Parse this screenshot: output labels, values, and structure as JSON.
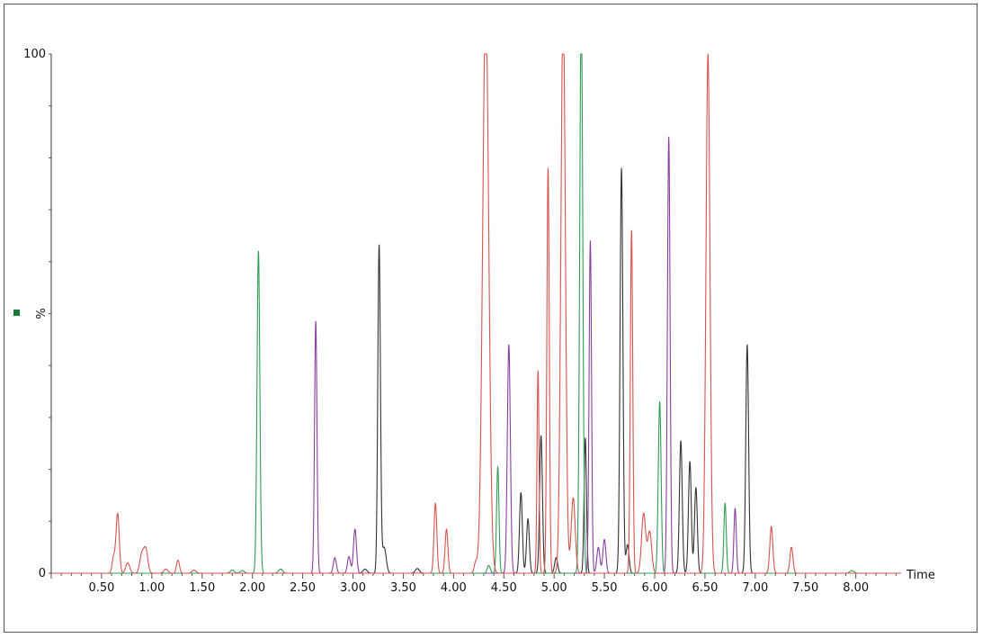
{
  "chart_data": {
    "type": "line",
    "title": "",
    "xlabel": "Time",
    "ylabel": "%",
    "xlim": [
      0.0,
      8.45
    ],
    "ylim": [
      0,
      100
    ],
    "x_ticks": [
      "0.50",
      "1.00",
      "1.50",
      "2.00",
      "2.50",
      "3.00",
      "3.50",
      "4.00",
      "4.50",
      "5.00",
      "5.50",
      "6.00",
      "6.50",
      "7.00",
      "7.50",
      "8.00"
    ],
    "y_ticks": [
      "0",
      "100"
    ],
    "marker_color": "#1a7a3a",
    "grid": false,
    "series_colors": {
      "red": "#d9534f",
      "green": "#2e9e55",
      "purple": "#8a3fa0",
      "black": "#333333"
    },
    "peaks": [
      {
        "color": "red",
        "x": 0.62,
        "h": 3.0,
        "w": 0.015
      },
      {
        "color": "red",
        "x": 0.66,
        "h": 11.5,
        "w": 0.016
      },
      {
        "color": "red",
        "x": 0.76,
        "h": 2.0,
        "w": 0.02
      },
      {
        "color": "red",
        "x": 0.9,
        "h": 3.5,
        "w": 0.02
      },
      {
        "color": "red",
        "x": 0.94,
        "h": 4.5,
        "w": 0.02
      },
      {
        "color": "red",
        "x": 1.14,
        "h": 0.8,
        "w": 0.02
      },
      {
        "color": "red",
        "x": 1.26,
        "h": 2.5,
        "w": 0.015
      },
      {
        "color": "red",
        "x": 1.42,
        "h": 0.6,
        "w": 0.02
      },
      {
        "color": "green",
        "x": 1.8,
        "h": 0.6,
        "w": 0.02
      },
      {
        "color": "green",
        "x": 1.9,
        "h": 0.5,
        "w": 0.02
      },
      {
        "color": "green",
        "x": 2.06,
        "h": 62,
        "w": 0.014
      },
      {
        "color": "green",
        "x": 2.28,
        "h": 0.8,
        "w": 0.02
      },
      {
        "color": "purple",
        "x": 2.63,
        "h": 48.5,
        "w": 0.012
      },
      {
        "color": "purple",
        "x": 2.82,
        "h": 3.0,
        "w": 0.015
      },
      {
        "color": "purple",
        "x": 2.96,
        "h": 3.2,
        "w": 0.015
      },
      {
        "color": "purple",
        "x": 3.02,
        "h": 8.5,
        "w": 0.015
      },
      {
        "color": "black",
        "x": 3.12,
        "h": 0.8,
        "w": 0.02
      },
      {
        "color": "black",
        "x": 3.26,
        "h": 63,
        "w": 0.013
      },
      {
        "color": "black",
        "x": 3.31,
        "h": 5.0,
        "w": 0.02
      },
      {
        "color": "black",
        "x": 3.64,
        "h": 0.9,
        "w": 0.02
      },
      {
        "color": "red",
        "x": 3.82,
        "h": 13.5,
        "w": 0.014
      },
      {
        "color": "red",
        "x": 3.93,
        "h": 8.5,
        "w": 0.014
      },
      {
        "color": "red",
        "x": 4.22,
        "h": 2.0,
        "w": 0.015
      },
      {
        "color": "red",
        "x": 4.32,
        "h": 110,
        "w": 0.03
      },
      {
        "color": "green",
        "x": 4.35,
        "h": 1.5,
        "w": 0.015
      },
      {
        "color": "green",
        "x": 4.44,
        "h": 20.5,
        "w": 0.012
      },
      {
        "color": "purple",
        "x": 4.55,
        "h": 44,
        "w": 0.015
      },
      {
        "color": "black",
        "x": 4.67,
        "h": 15.5,
        "w": 0.014
      },
      {
        "color": "black",
        "x": 4.74,
        "h": 10.5,
        "w": 0.014
      },
      {
        "color": "red",
        "x": 4.84,
        "h": 39,
        "w": 0.01
      },
      {
        "color": "black",
        "x": 4.87,
        "h": 26.5,
        "w": 0.014
      },
      {
        "color": "red",
        "x": 4.94,
        "h": 78,
        "w": 0.012
      },
      {
        "color": "black",
        "x": 5.02,
        "h": 3.0,
        "w": 0.015
      },
      {
        "color": "red",
        "x": 5.09,
        "h": 110,
        "w": 0.022
      },
      {
        "color": "red",
        "x": 5.19,
        "h": 14.5,
        "w": 0.02
      },
      {
        "color": "green",
        "x": 5.27,
        "h": 110,
        "w": 0.015
      },
      {
        "color": "black",
        "x": 5.31,
        "h": 26,
        "w": 0.012
      },
      {
        "color": "purple",
        "x": 5.36,
        "h": 64,
        "w": 0.012
      },
      {
        "color": "purple",
        "x": 5.44,
        "h": 5.0,
        "w": 0.015
      },
      {
        "color": "purple",
        "x": 5.5,
        "h": 6.5,
        "w": 0.015
      },
      {
        "color": "black",
        "x": 5.67,
        "h": 78,
        "w": 0.014
      },
      {
        "color": "black",
        "x": 5.73,
        "h": 5.5,
        "w": 0.015
      },
      {
        "color": "red",
        "x": 5.77,
        "h": 66,
        "w": 0.012
      },
      {
        "color": "red",
        "x": 5.89,
        "h": 11.5,
        "w": 0.02
      },
      {
        "color": "red",
        "x": 5.95,
        "h": 8.0,
        "w": 0.02
      },
      {
        "color": "green",
        "x": 6.05,
        "h": 33,
        "w": 0.014
      },
      {
        "color": "purple",
        "x": 6.14,
        "h": 84,
        "w": 0.013
      },
      {
        "color": "black",
        "x": 6.26,
        "h": 25.5,
        "w": 0.014
      },
      {
        "color": "black",
        "x": 6.35,
        "h": 21.5,
        "w": 0.014
      },
      {
        "color": "black",
        "x": 6.41,
        "h": 16.5,
        "w": 0.014
      },
      {
        "color": "red",
        "x": 6.53,
        "h": 100,
        "w": 0.02
      },
      {
        "color": "green",
        "x": 6.7,
        "h": 13.5,
        "w": 0.012
      },
      {
        "color": "purple",
        "x": 6.8,
        "h": 12.5,
        "w": 0.012
      },
      {
        "color": "black",
        "x": 6.92,
        "h": 44,
        "w": 0.014
      },
      {
        "color": "red",
        "x": 7.16,
        "h": 9.0,
        "w": 0.015
      },
      {
        "color": "red",
        "x": 7.36,
        "h": 5.0,
        "w": 0.015
      },
      {
        "color": "green",
        "x": 7.96,
        "h": 0.5,
        "w": 0.02
      }
    ]
  }
}
